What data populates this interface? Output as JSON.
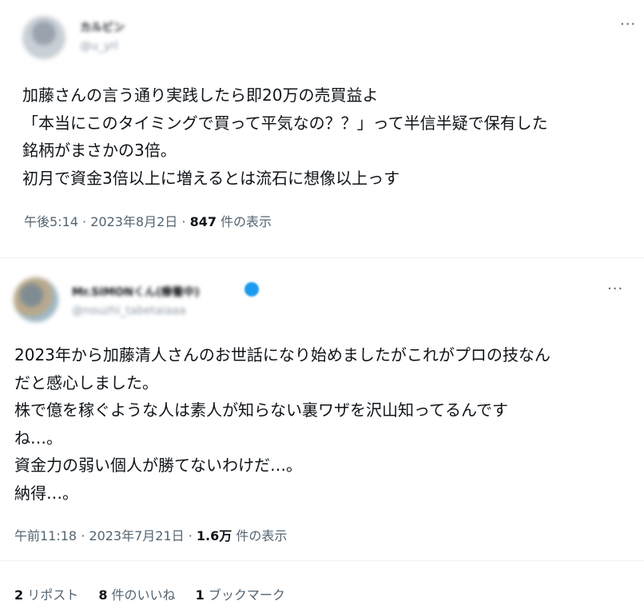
{
  "tweet1": {
    "author_name": "カルビン",
    "author_handle": "@u_yrl",
    "more_label": "···",
    "lines": [
      "加藤さんの言う通り実践したら即20万の売買益よ",
      "「本当にこのタイミングで買って平気なの？？」って半信半疑で保有した",
      "銘柄がまさかの3倍。",
      "初月で資金3倍以上に増えるとは流石に想像以上っす"
    ],
    "time": "午後5:14",
    "date": "2023年8月2日",
    "sep": " · ",
    "views_count": "847",
    "views_label": " 件の表示"
  },
  "tweet2": {
    "author_name": "Mr.SIMONくん(療養中)",
    "author_handle": "@nouzhi_tabetaiaaa",
    "more_label": "···",
    "lines": [
      "2023年から加藤清人さんのお世話になり始めましたがこれがプロの技なん",
      "だと感心しました。",
      "株で億を稼ぐような人は素人が知らない裏ワザを沢山知ってるんです",
      "ね…。",
      "資金力の弱い個人が勝てないわけだ…。",
      "納得…。"
    ],
    "time": "午前11:18",
    "date": "2023年7月21日",
    "sep": " · ",
    "views_count": "1.6万",
    "views_label": " 件の表示",
    "stats": {
      "reposts_count": "2",
      "reposts_label": " リポスト",
      "likes_count": "8",
      "likes_label": " 件のいいね",
      "bookmarks_count": "1",
      "bookmarks_label": " ブックマーク"
    }
  },
  "colors": {
    "text": "#0f1419",
    "muted": "#536471",
    "verified": "#1d9bf0",
    "divider": "#eff3f4"
  }
}
